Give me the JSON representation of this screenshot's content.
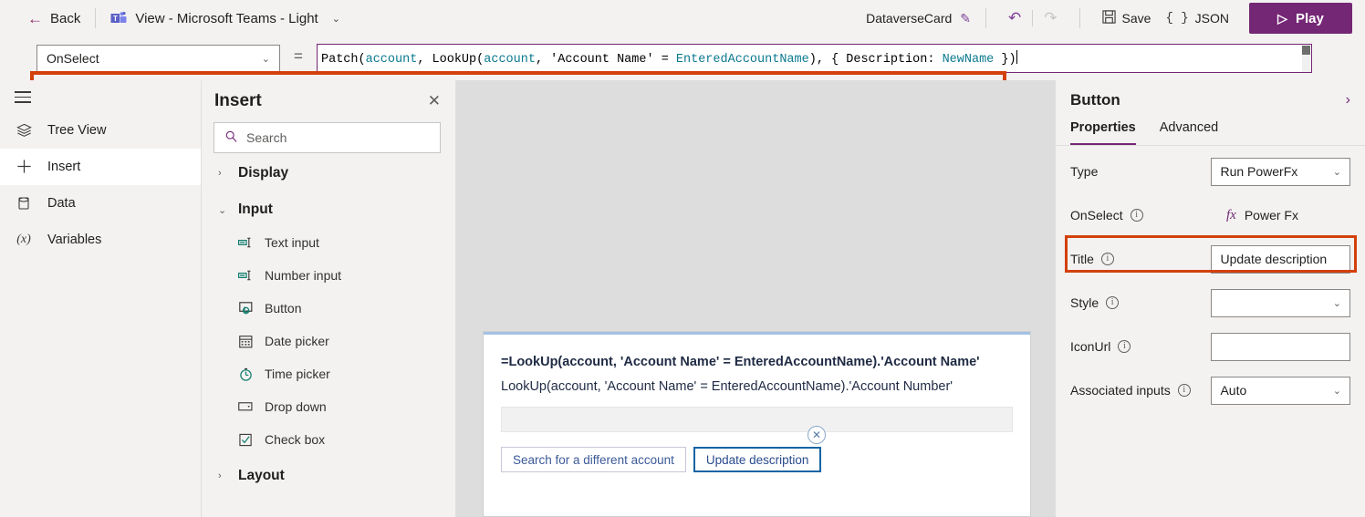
{
  "topbar": {
    "back_label": "Back",
    "back_icon": "arrow-left-icon",
    "app_icon": "microsoft-teams-icon",
    "view_title": "View - Microsoft Teams - Light",
    "view_chevron": "chevron-down-icon",
    "doc_name": "DataverseCard",
    "edit_icon": "pencil-icon",
    "undo_icon": "undo-icon",
    "redo_icon": "redo-icon",
    "save_label": "Save",
    "save_icon": "save-disk-icon",
    "json_label": "JSON",
    "json_icon": "curly-braces-icon",
    "play_label": "Play",
    "play_icon": "play-triangle-icon"
  },
  "formula_bar": {
    "property_selected": "OnSelect",
    "property_chevron": "chevron-down-icon",
    "equals": "=",
    "formula_full": "Patch(account, LookUp(account, 'Account Name' = EnteredAccountName), { Description: NewName })",
    "tokens": {
      "t1": "Patch(",
      "t2": "account",
      "t3": ", LookUp(",
      "t4": "account",
      "t5": ", 'Account Name' = ",
      "t6": "EnteredAccountName",
      "t7": "), { Description: ",
      "t8": "NewName",
      "t9": " })"
    },
    "expand_chevron": "chevron-down-icon",
    "border_color": "#742774",
    "annotation_color": "#d3400b"
  },
  "rail": {
    "menu_icon": "hamburger-menu-icon",
    "items": [
      {
        "label": "Tree View",
        "icon": "layers-icon",
        "active": false
      },
      {
        "label": "Insert",
        "icon": "plus-icon",
        "active": true
      },
      {
        "label": "Data",
        "icon": "database-icon",
        "active": false
      },
      {
        "label": "Variables",
        "icon": "variable-x-icon",
        "active": false
      }
    ]
  },
  "insert_panel": {
    "title": "Insert",
    "close_icon": "close-icon",
    "search_placeholder": "Search",
    "search_icon": "search-icon",
    "groups": [
      {
        "label": "Display",
        "expanded": false,
        "chevron": "chevron-right-icon",
        "items": []
      },
      {
        "label": "Input",
        "expanded": true,
        "chevron": "chevron-down-icon",
        "items": [
          {
            "label": "Text input",
            "icon": "text-input-icon"
          },
          {
            "label": "Number input",
            "icon": "number-input-icon"
          },
          {
            "label": "Button",
            "icon": "button-cursor-icon"
          },
          {
            "label": "Date picker",
            "icon": "calendar-icon"
          },
          {
            "label": "Time picker",
            "icon": "clock-icon"
          },
          {
            "label": "Drop down",
            "icon": "dropdown-icon"
          },
          {
            "label": "Check box",
            "icon": "checkbox-icon"
          }
        ]
      },
      {
        "label": "Layout",
        "expanded": false,
        "chevron": "chevron-right-icon",
        "items": []
      }
    ]
  },
  "canvas": {
    "card": {
      "line1": "=LookUp(account, 'Account Name' = EnteredAccountName).'Account Name'",
      "line2": "LookUp(account, 'Account Name' = EnteredAccountName).'Account Number'",
      "input_value": "",
      "buttons": [
        {
          "label": "Search for a different account",
          "selected": false
        },
        {
          "label": "Update description",
          "selected": true
        }
      ],
      "delete_handle_icon": "circle-x-icon"
    }
  },
  "properties": {
    "title": "Button",
    "expand_icon": "chevron-right-icon",
    "tabs": [
      {
        "label": "Properties",
        "active": true
      },
      {
        "label": "Advanced",
        "active": false
      }
    ],
    "rows": [
      {
        "label": "Type",
        "info": false,
        "control": "select",
        "value": "Run PowerFx",
        "chevron": "chevron-down-icon"
      },
      {
        "label": "OnSelect",
        "info": true,
        "control": "powerfx",
        "value": "Power Fx",
        "fx_icon": "fx-icon"
      },
      {
        "label": "Title",
        "info": true,
        "control": "text",
        "value": "Update description",
        "highlighted": true
      },
      {
        "label": "Style",
        "info": true,
        "control": "select",
        "value": "",
        "chevron": "chevron-down-icon"
      },
      {
        "label": "IconUrl",
        "info": true,
        "control": "text",
        "value": ""
      },
      {
        "label": "Associated inputs",
        "info": true,
        "control": "select",
        "value": "Auto",
        "chevron": "chevron-down-icon"
      }
    ]
  }
}
